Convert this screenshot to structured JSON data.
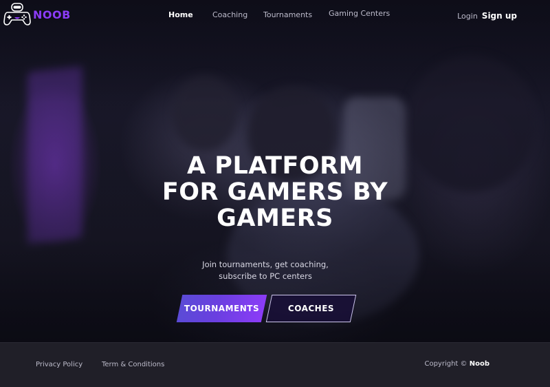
{
  "brand": {
    "name": "NOOB",
    "accent": "#8b3cf7",
    "icon": "gamepad-robot-icon"
  },
  "nav": {
    "links": [
      {
        "label": "Home",
        "active": true
      },
      {
        "label": "Coaching",
        "active": false
      },
      {
        "label": "Tournaments",
        "active": false
      },
      {
        "label": "Gaming Centers",
        "active": false
      }
    ],
    "login_label": "Login",
    "signup_label": "Sign up"
  },
  "hero": {
    "headline": [
      "A PLATFORM",
      "FOR GAMERS BY",
      "GAMERS"
    ],
    "subtitle": [
      "Join tournaments, get coaching,",
      "subscribe to PC centers"
    ],
    "primary_button": "TOURNAMENTS",
    "secondary_button": "COACHES",
    "primary_gradient": [
      "#5b4bd6",
      "#8b3cf7"
    ]
  },
  "footer": {
    "links": [
      "Privacy Policy",
      "Term & Conditions"
    ],
    "copyright_prefix": "Copyright ©",
    "copyright_name": "Noob"
  }
}
